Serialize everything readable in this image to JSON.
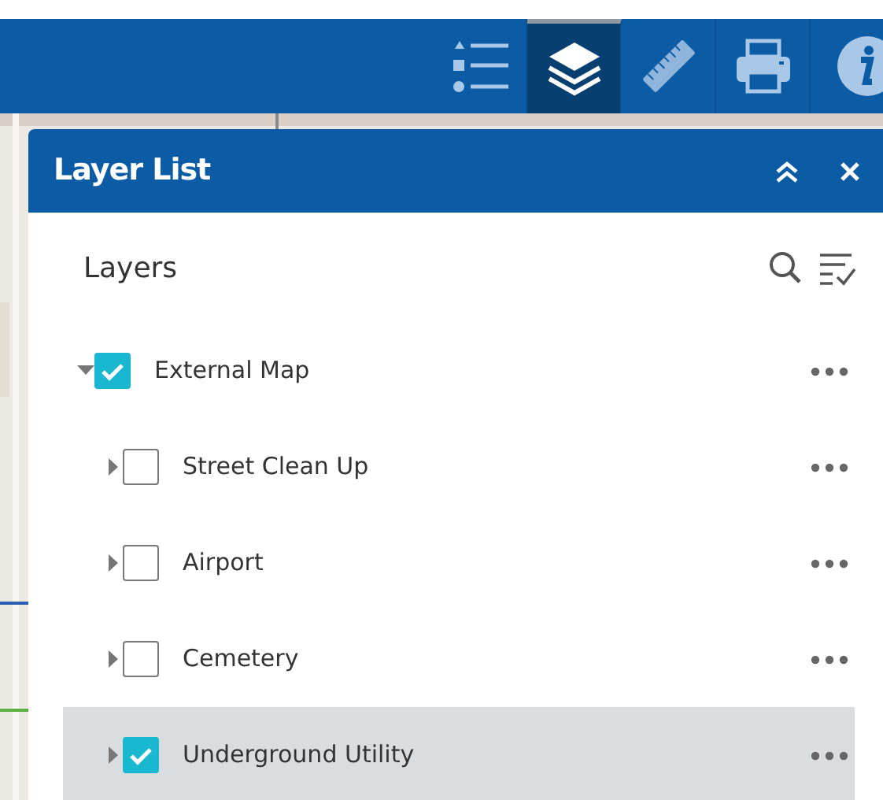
{
  "toolbar": {
    "tools": [
      {
        "kind": "legend",
        "selected": false
      },
      {
        "kind": "layers",
        "selected": true
      },
      {
        "kind": "measure",
        "selected": false
      },
      {
        "kind": "print",
        "selected": false
      },
      {
        "kind": "about",
        "selected": false
      }
    ]
  },
  "panel": {
    "title": "Layer List",
    "heading": "Layers",
    "layers": [
      {
        "label": "External Map",
        "checked": true,
        "expanded": true,
        "selected": false,
        "children": [
          {
            "label": "Street Clean Up",
            "checked": false,
            "expanded": false,
            "selected": false
          },
          {
            "label": "Airport",
            "checked": false,
            "expanded": false,
            "selected": false
          },
          {
            "label": "Cemetery",
            "checked": false,
            "expanded": false,
            "selected": false
          },
          {
            "label": "Underground Utility",
            "checked": true,
            "expanded": false,
            "selected": true
          }
        ]
      }
    ]
  }
}
